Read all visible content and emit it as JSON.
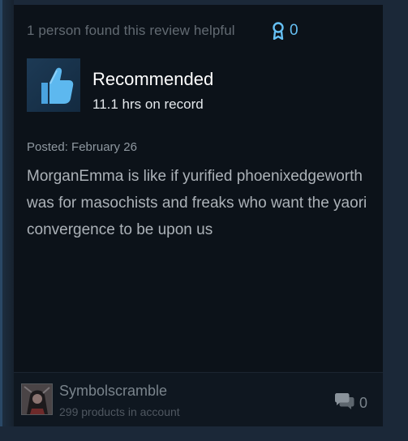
{
  "review": {
    "helpful_text": "1 person found this review helpful",
    "award_count": "0",
    "verdict": "Recommended",
    "hours": "11.1 hrs on record",
    "posted": "Posted: February 26",
    "body": "MorganEmma is like if yurified phoenixedgeworth was for masochists and freaks who want the yaori convergence to be upon us"
  },
  "author": {
    "name": "Symbolscramble",
    "products": "299 products in account"
  },
  "footer": {
    "comment_count": "0"
  },
  "icons": {
    "award": "award-ribbon-icon",
    "thumb": "thumbs-up-icon",
    "comment": "comment-bubbles-icon"
  },
  "colors": {
    "accent": "#66c0f4",
    "background": "#1b2838",
    "card": "#0c1219"
  }
}
